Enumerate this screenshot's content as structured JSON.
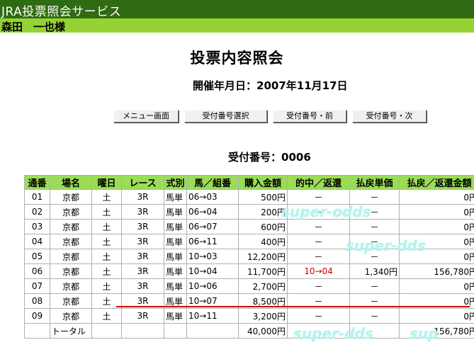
{
  "header": {
    "service_title": "JRA投票照会サービス",
    "user_name": "森田　一也様"
  },
  "page": {
    "title": "投票内容照会",
    "date_label": "開催年月日：",
    "date_value": "2007年11月17日",
    "receipt_label": "受付番号：",
    "receipt_value": "0006"
  },
  "buttons": {
    "menu": "メニュー画面",
    "select_receipt": "受付番号選択",
    "prev_receipt": "受付番号・前",
    "next_receipt": "受付番号・次"
  },
  "table": {
    "columns": [
      "通番",
      "場名",
      "曜日",
      "レース",
      "式別",
      "馬／組番",
      "購入金額",
      "的中／返還",
      "払戻単価",
      "払戻／返還金額"
    ],
    "rows": [
      {
        "no": "01",
        "venue": "京都",
        "day": "土",
        "race": "3R",
        "type": "馬単",
        "combo": "06→03",
        "amount": "500円",
        "hit": "－",
        "unit": "－",
        "payout": "0円"
      },
      {
        "no": "02",
        "venue": "京都",
        "day": "土",
        "race": "3R",
        "type": "馬単",
        "combo": "06→04",
        "amount": "200円",
        "hit": "－",
        "unit": "－",
        "payout": "0円"
      },
      {
        "no": "03",
        "venue": "京都",
        "day": "土",
        "race": "3R",
        "type": "馬単",
        "combo": "06→07",
        "amount": "600円",
        "hit": "－",
        "unit": "－",
        "payout": "0円"
      },
      {
        "no": "04",
        "venue": "京都",
        "day": "土",
        "race": "3R",
        "type": "馬単",
        "combo": "06→11",
        "amount": "400円",
        "hit": "－",
        "unit": "－",
        "payout": "0円"
      },
      {
        "no": "05",
        "venue": "京都",
        "day": "土",
        "race": "3R",
        "type": "馬単",
        "combo": "10→03",
        "amount": "12,200円",
        "hit": "－",
        "unit": "－",
        "payout": "0円"
      },
      {
        "no": "06",
        "venue": "京都",
        "day": "土",
        "race": "3R",
        "type": "馬単",
        "combo": "10→04",
        "amount": "11,700円",
        "hit": "10→04",
        "unit": "1,340円",
        "payout": "156,780円"
      },
      {
        "no": "07",
        "venue": "京都",
        "day": "土",
        "race": "3R",
        "type": "馬単",
        "combo": "10→06",
        "amount": "2,700円",
        "hit": "－",
        "unit": "－",
        "payout": "0円"
      },
      {
        "no": "08",
        "venue": "京都",
        "day": "土",
        "race": "3R",
        "type": "馬単",
        "combo": "10→07",
        "amount": "8,500円",
        "hit": "－",
        "unit": "－",
        "payout": "0円"
      },
      {
        "no": "09",
        "venue": "京都",
        "day": "土",
        "race": "3R",
        "type": "馬単",
        "combo": "10→11",
        "amount": "3,200円",
        "hit": "－",
        "unit": "－",
        "payout": "0円"
      }
    ],
    "total": {
      "label": "トータル",
      "amount": "40,000円",
      "payout": "156,780円"
    }
  },
  "watermarks": [
    "super-odds",
    "super-dds",
    "super-dds",
    "sup"
  ],
  "colors": {
    "title_bar": "#2f6b12",
    "user_bar": "#97d234",
    "table_header": "#9bdc57",
    "hit_text": "#cc0000",
    "watermark": "#b8f3ee"
  }
}
